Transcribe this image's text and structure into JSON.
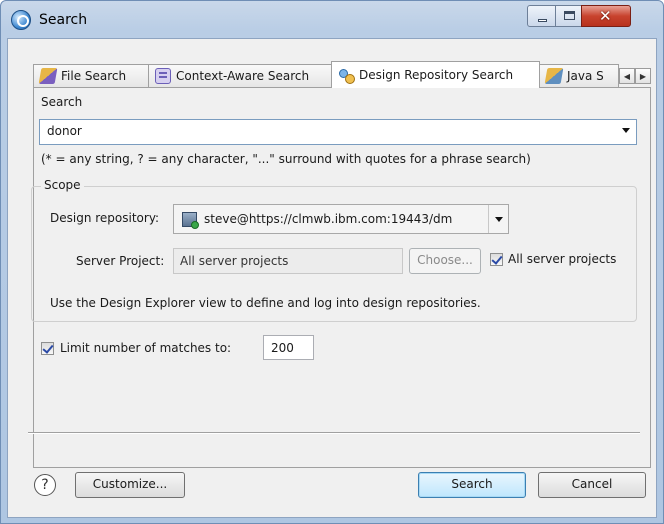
{
  "window": {
    "title": "Search"
  },
  "tabs": [
    {
      "label": "File Search",
      "icon": "file-search-icon"
    },
    {
      "label": "Context-Aware Search",
      "icon": "context-search-icon"
    },
    {
      "label": "Design Repository Search",
      "icon": "repository-search-icon",
      "active": true
    },
    {
      "label": "Java S",
      "icon": "java-search-icon"
    }
  ],
  "search": {
    "label": "Search",
    "value": "donor",
    "hint": "(* = any string, ? = any character, \"...\" surround with quotes for a phrase search)"
  },
  "scope": {
    "title": "Scope",
    "repo_label": "Design repository:",
    "repo_value": "steve@https://clmwb.ibm.com:19443/dm",
    "server_project_label": "Server Project:",
    "server_project_value": "All server projects",
    "choose_label": "Choose...",
    "all_server_projects_label": "All server projects",
    "all_server_projects_checked": true,
    "info": "Use the Design Explorer view to define and log into design repositories."
  },
  "limit": {
    "label": "Limit number of matches to:",
    "checked": true,
    "value": "200"
  },
  "buttons": {
    "help": "?",
    "customize": "Customize...",
    "search": "Search",
    "cancel": "Cancel"
  },
  "colors": {
    "default_button": "#bee6fd",
    "close_button": "#c8432e"
  }
}
